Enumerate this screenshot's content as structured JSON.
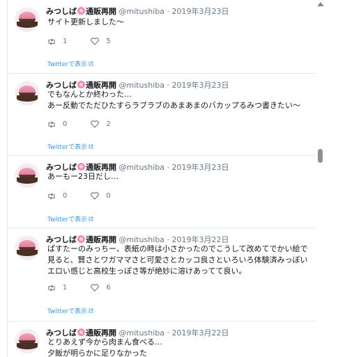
{
  "tweets": [
    {
      "name": "みつしば",
      "suffix": "通販再開",
      "handle": "@mitushiba",
      "date": "· 2019年3月23日",
      "lines": [
        "サイト更新しました〜"
      ],
      "retweets": "1",
      "likes": "5",
      "view_link": "Twitterで表示"
    },
    {
      "name": "みつしば",
      "suffix": "通販再開",
      "handle": "@mitushiba",
      "date": "· 2019年3月23日",
      "lines": [
        "でもなんとか終わった…",
        "あー反動でただひたすらラブラブのあまあまのバカップるみつ書きたい〜"
      ],
      "retweets": "0",
      "likes": "2",
      "view_link": "Twitterで表示"
    },
    {
      "name": "みつしば",
      "suffix": "通販再開",
      "handle": "@mitushiba",
      "date": "· 2019年3月23日",
      "lines": [
        "あーもー23日だし…"
      ],
      "retweets": "0",
      "likes": "0",
      "view_link": "Twitterで表示"
    },
    {
      "name": "みつしば",
      "suffix": "通販再開",
      "handle": "@mitushiba",
      "date": "· 2019年3月22日",
      "lines": [
        "ぱすたーのみっちー、表紙の時は小さかったのでこうして改めてでかい絵で",
        "見ると、賢さとワガママさと可愛さとカッコ良さといろいろ体験済みっぽい",
        "エロい感じと高校生っぽさ等が絶妙に溶けあってて良い。"
      ],
      "retweets": "1",
      "likes": "6",
      "view_link": "Twitterで表示"
    },
    {
      "name": "みつしば",
      "suffix": "通販再開",
      "handle": "@mitushiba",
      "date": "· 2019年3月22日",
      "lines": [
        "とりあえず今から肉まん食べる…",
        "夕飯が明らかに足りなかった"
      ]
    }
  ]
}
